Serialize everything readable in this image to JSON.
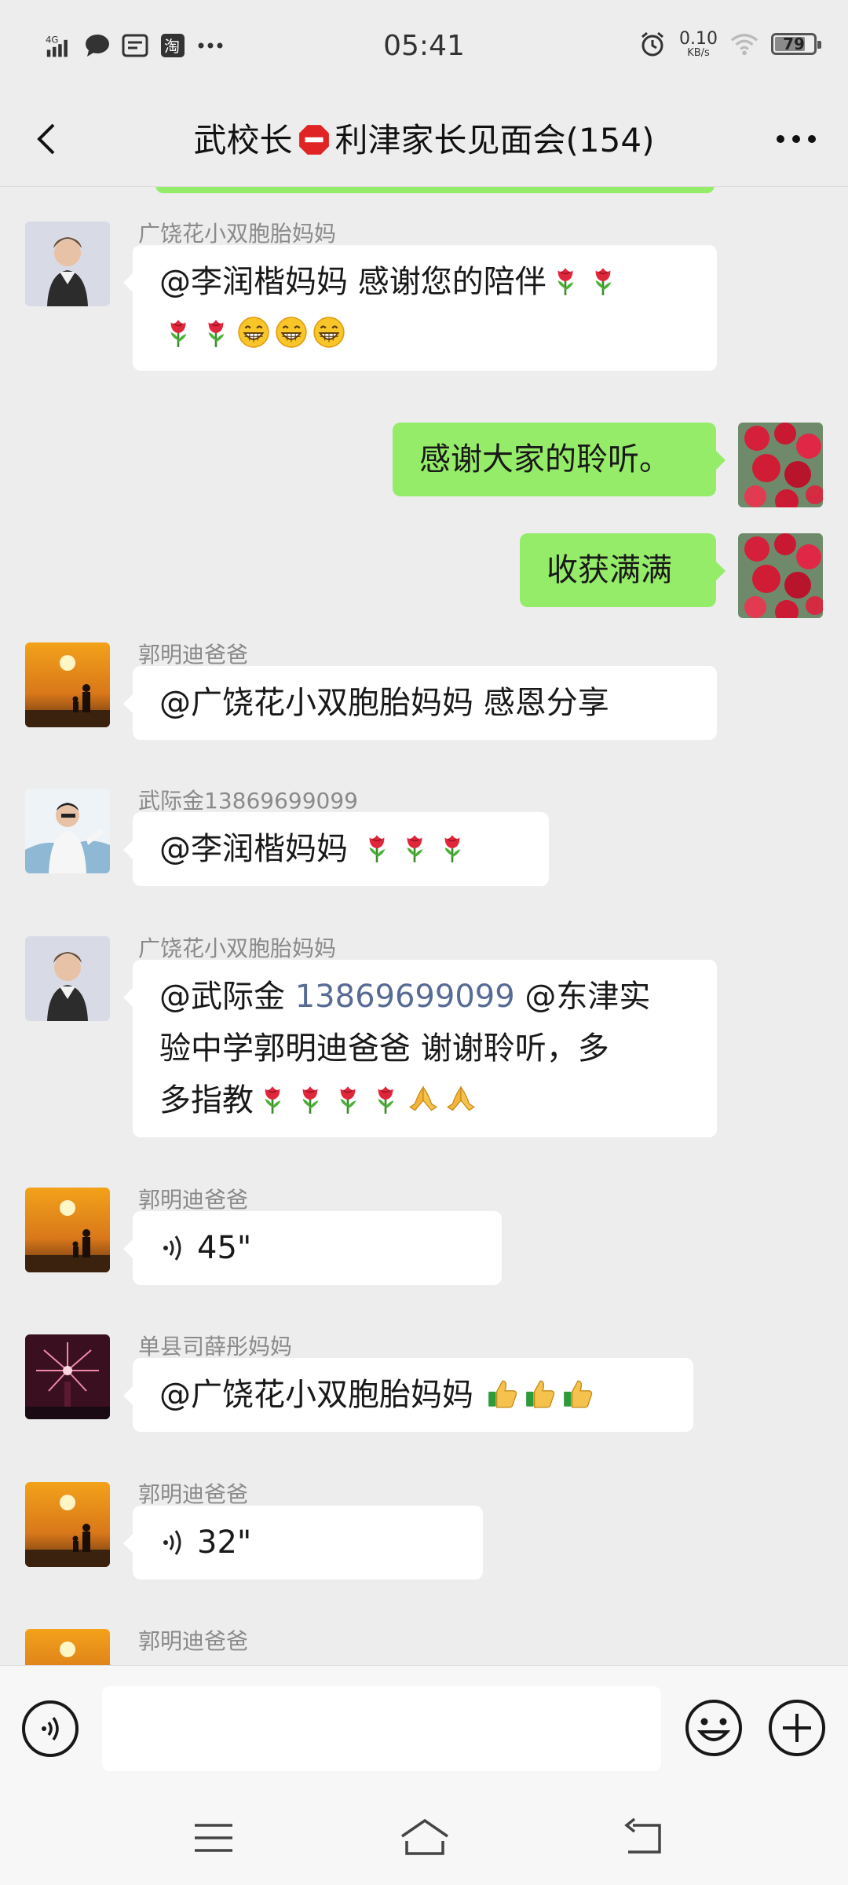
{
  "status_bar": {
    "network": "4G",
    "time": "05:41",
    "net_speed_value": "0.10",
    "net_speed_unit": "KB/s",
    "battery": "79",
    "battery_level": 0.79
  },
  "header": {
    "title_prefix": "武校长",
    "title_suffix": "利津家长见面会(154)"
  },
  "messages": [
    {
      "sender": "广饶花小双胞胎妈妈",
      "line1": "@李润楷妈妈  感谢您的陪伴",
      "emoji": [
        "rose",
        "rose",
        "rose",
        "rose",
        "grin",
        "grin",
        "grin"
      ]
    },
    {
      "self": true,
      "text": "感谢大家的聆听。"
    },
    {
      "self": true,
      "text": "收获满满"
    },
    {
      "sender": "郭明迪爸爸",
      "text": "@广饶花小双胞胎妈妈  感恩分享"
    },
    {
      "sender": "武际金13869699099",
      "text": "@李润楷妈妈  ",
      "emoji": [
        "rose",
        "rose",
        "rose"
      ]
    },
    {
      "sender": "广饶花小双胞胎妈妈",
      "prefix": "@武际金 ",
      "phone": "13869699099",
      "rest1": " @东津实",
      "line2": "验中学郭明迪爸爸  谢谢聆听，多",
      "line3": "多指教",
      "emoji": [
        "rose",
        "rose",
        "rose",
        "rose",
        "pray",
        "pray"
      ]
    },
    {
      "sender": "郭明迪爸爸",
      "voice": "45\""
    },
    {
      "sender": "单县司薛彤妈妈",
      "text": "@广饶花小双胞胎妈妈  ",
      "emoji": [
        "thumbs",
        "thumbs",
        "thumbs"
      ]
    },
    {
      "sender": "郭明迪爸爸",
      "voice": "32\""
    },
    {
      "sender": "郭明迪爸爸"
    }
  ],
  "icons": {
    "back": "back-arrow-icon",
    "more": "more-dots-icon",
    "voice_input": "voice-input-icon",
    "emoji": "emoji-icon",
    "plus": "plus-icon",
    "nav_menu": "menu-icon",
    "nav_home": "home-icon",
    "nav_back": "back-icon"
  }
}
